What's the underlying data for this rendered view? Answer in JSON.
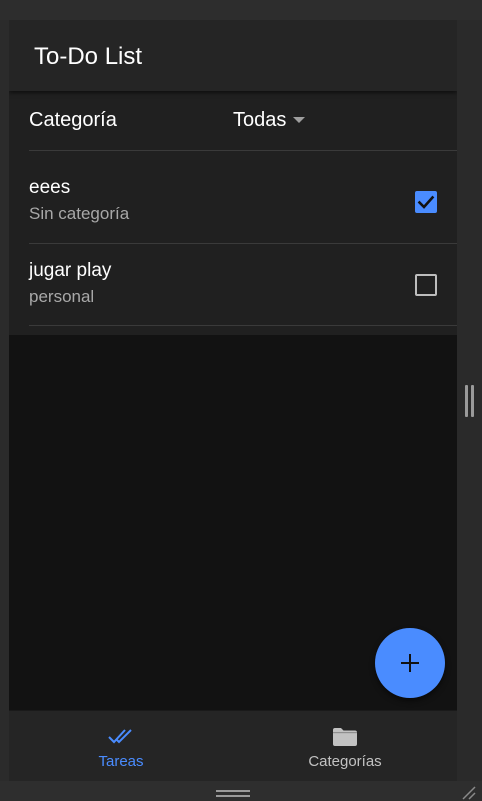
{
  "app": {
    "title": "To-Do List"
  },
  "filter": {
    "label": "Categoría",
    "selected": "Todas"
  },
  "tasks": [
    {
      "title": "eees",
      "category": "Sin categoría",
      "done": true
    },
    {
      "title": "jugar play",
      "category": "personal",
      "done": false
    }
  ],
  "fab": {
    "icon": "plus-icon"
  },
  "bottom_nav": {
    "items": [
      {
        "label": "Tareas",
        "icon": "double-check-icon",
        "active": true
      },
      {
        "label": "Categorías",
        "icon": "folder-icon",
        "active": false
      }
    ]
  },
  "colors": {
    "accent": "#4a8cff",
    "background": "#121212",
    "surface": "#252525",
    "list_background": "#202020",
    "secondary_text": "#a8a8a8"
  }
}
